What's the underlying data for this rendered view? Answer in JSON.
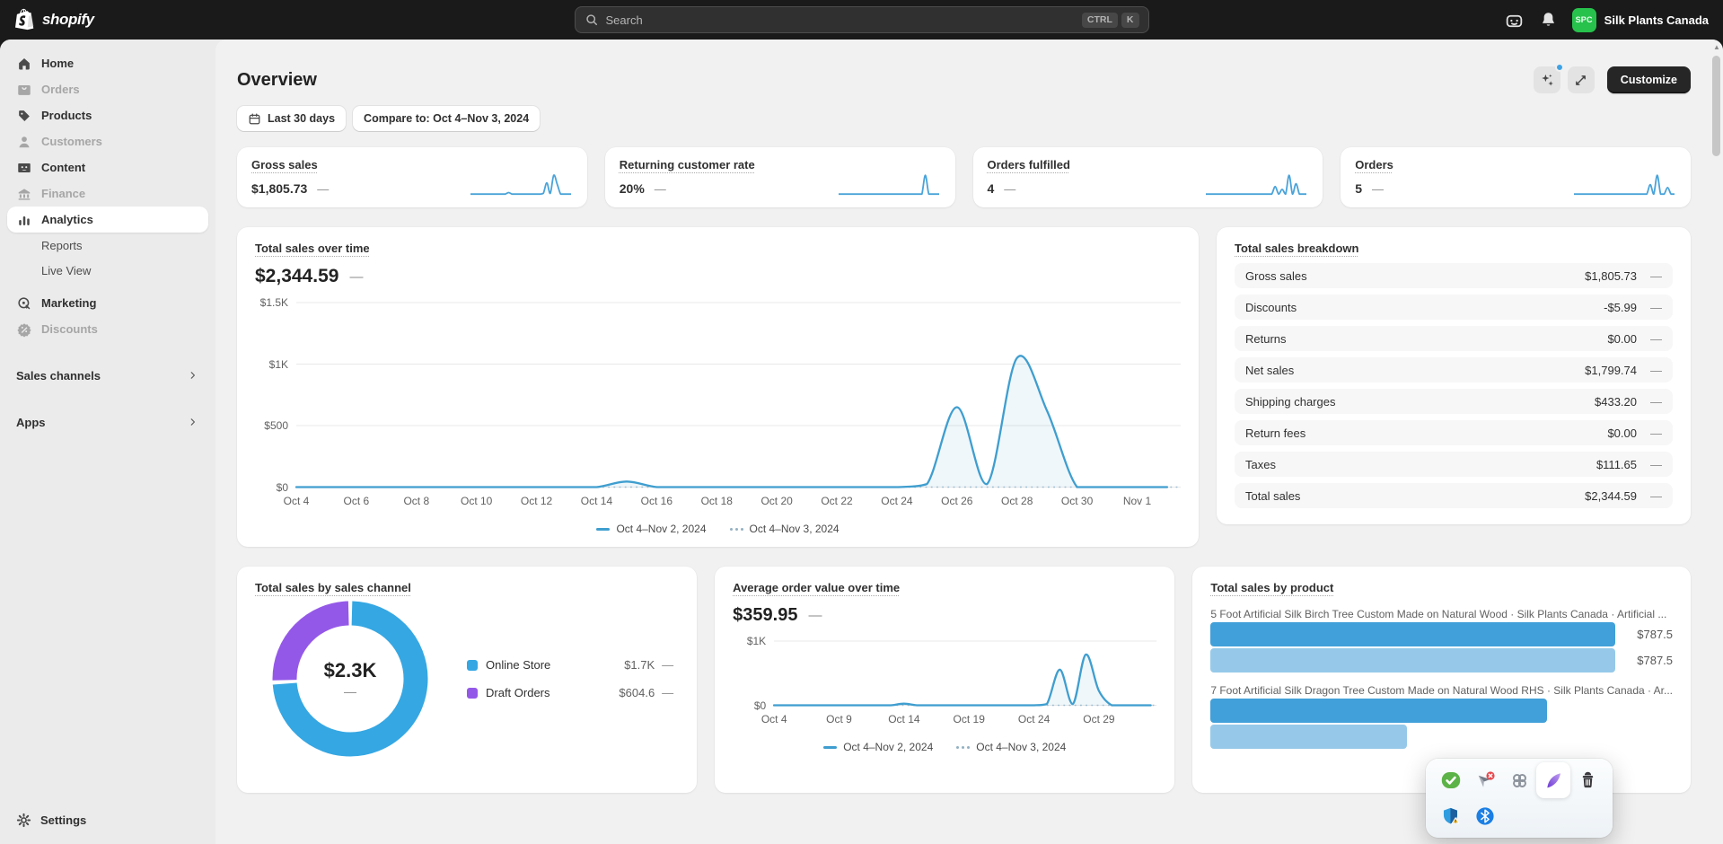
{
  "ui": {
    "dash": "—",
    "accent_blue": "#3f9ecf",
    "donut_blue": "#35a7e3",
    "donut_purple": "#9458e8",
    "bar_dark": "#41a0d9",
    "bar_light": "#96c9e9",
    "spark_color": "#4aa3d9",
    "avatar_green": "#27c24c"
  },
  "topbar": {
    "brand": "shopify",
    "search_placeholder": "Search",
    "shortcut_ctrl": "CTRL",
    "shortcut_k": "K",
    "store_initials": "SPC",
    "store_name": "Silk Plants Canada"
  },
  "sidebar": {
    "items": [
      {
        "label": "Home",
        "icon": "home",
        "state": "default"
      },
      {
        "label": "Orders",
        "icon": "orders",
        "state": "disabled"
      },
      {
        "label": "Products",
        "icon": "products",
        "state": "default"
      },
      {
        "label": "Customers",
        "icon": "customers",
        "state": "disabled"
      },
      {
        "label": "Content",
        "icon": "content",
        "state": "default"
      },
      {
        "label": "Finance",
        "icon": "finance",
        "state": "disabled"
      },
      {
        "label": "Analytics",
        "icon": "analytics",
        "state": "active"
      },
      {
        "label": "Reports",
        "icon": null,
        "state": "sub"
      },
      {
        "label": "Live View",
        "icon": null,
        "state": "sub"
      },
      {
        "label": "Marketing",
        "icon": "marketing",
        "state": "default"
      },
      {
        "label": "Discounts",
        "icon": "discounts",
        "state": "disabled"
      }
    ],
    "sections": [
      {
        "label": "Sales channels"
      },
      {
        "label": "Apps"
      }
    ],
    "settings_label": "Settings"
  },
  "page": {
    "title": "Overview",
    "customize": "Customize",
    "filters": {
      "date_range": "Last 30 days",
      "compare": "Compare to: Oct 4–Nov 3, 2024"
    }
  },
  "metrics": [
    {
      "title": "Gross sales",
      "value": "$1,805.73",
      "spark": [
        0,
        0,
        0,
        0,
        0,
        0,
        0,
        0,
        0,
        0,
        0,
        6,
        0,
        0,
        0,
        0,
        0,
        0,
        0,
        0,
        0,
        3,
        45,
        3,
        75,
        40,
        0,
        0,
        0,
        0
      ]
    },
    {
      "title": "Returning customer rate",
      "value": "20%",
      "spark": [
        0,
        0,
        0,
        0,
        0,
        0,
        0,
        0,
        0,
        0,
        0,
        0,
        0,
        0,
        0,
        0,
        0,
        0,
        0,
        0,
        0,
        0,
        0,
        0,
        0,
        100,
        0,
        0,
        0,
        0
      ]
    },
    {
      "title": "Orders fulfilled",
      "value": "4",
      "spark": [
        0,
        0,
        0,
        0,
        0,
        0,
        0,
        0,
        0,
        0,
        0,
        0,
        0,
        0,
        0,
        0,
        0,
        0,
        0,
        0,
        40,
        0,
        25,
        0,
        100,
        0,
        55,
        0,
        0,
        0
      ]
    },
    {
      "title": "Orders",
      "value": "5",
      "spark": [
        0,
        0,
        0,
        0,
        0,
        0,
        0,
        0,
        0,
        0,
        0,
        0,
        0,
        0,
        0,
        0,
        0,
        0,
        0,
        0,
        0,
        0,
        50,
        0,
        100,
        0,
        0,
        35,
        0,
        0
      ]
    }
  ],
  "chart_data": [
    {
      "id": "total-sales-over-time",
      "type": "line",
      "title": "Total sales over time",
      "value": "$2,344.59",
      "ylabel": "Total sales",
      "ymax": 1500,
      "yticks": [
        {
          "label": "$1.5K",
          "v": 1500
        },
        {
          "label": "$1K",
          "v": 1000
        },
        {
          "label": "$500",
          "v": 500
        },
        {
          "label": "$0",
          "v": 0
        }
      ],
      "xticks": [
        {
          "label": "Oct 4",
          "d": 0
        },
        {
          "label": "Oct 6",
          "d": 2
        },
        {
          "label": "Oct 8",
          "d": 4
        },
        {
          "label": "Oct 10",
          "d": 6
        },
        {
          "label": "Oct 12",
          "d": 8
        },
        {
          "label": "Oct 14",
          "d": 10
        },
        {
          "label": "Oct 16",
          "d": 12
        },
        {
          "label": "Oct 18",
          "d": 14
        },
        {
          "label": "Oct 20",
          "d": 16
        },
        {
          "label": "Oct 22",
          "d": 18
        },
        {
          "label": "Oct 24",
          "d": 20
        },
        {
          "label": "Oct 26",
          "d": 22
        },
        {
          "label": "Oct 28",
          "d": 24
        },
        {
          "label": "Oct 30",
          "d": 26
        },
        {
          "label": "Nov 1",
          "d": 28
        }
      ],
      "series": [
        {
          "name": "Oct 4–Nov 2, 2024",
          "values": [
            0,
            0,
            0,
            0,
            0,
            0,
            0,
            0,
            0,
            0,
            0,
            45,
            0,
            0,
            0,
            0,
            0,
            0,
            0,
            0,
            0,
            25,
            650,
            25,
            1050,
            620,
            0,
            0,
            0,
            0
          ]
        }
      ],
      "comparison_name": "Oct 4–Nov 3, 2024",
      "line_color": "#3f9ecf",
      "grid": true,
      "legend_position": "bottom"
    },
    {
      "id": "total-sales-by-channel",
      "type": "pie",
      "title": "Total sales by sales channel",
      "center_value": "$2.3K",
      "slices": [
        {
          "label": "Online Store",
          "value": 1739.99,
          "display": "$1.7K",
          "color": "#35a7e3"
        },
        {
          "label": "Draft Orders",
          "value": 604.6,
          "display": "$604.6",
          "color": "#9458e8"
        }
      ]
    },
    {
      "id": "average-order-value-over-time",
      "type": "line",
      "title": "Average order value over time",
      "value": "$359.95",
      "ymax": 1000,
      "yticks": [
        {
          "label": "$1K",
          "v": 1000
        },
        {
          "label": "$0",
          "v": 0
        }
      ],
      "xticks": [
        {
          "label": "Oct 4",
          "d": 0
        },
        {
          "label": "Oct 9",
          "d": 5
        },
        {
          "label": "Oct 14",
          "d": 10
        },
        {
          "label": "Oct 19",
          "d": 15
        },
        {
          "label": "Oct 24",
          "d": 20
        },
        {
          "label": "Oct 29",
          "d": 25
        }
      ],
      "series": [
        {
          "name": "Oct 4–Nov 2, 2024",
          "values": [
            0,
            0,
            0,
            0,
            0,
            0,
            0,
            0,
            0,
            0,
            25,
            0,
            0,
            0,
            0,
            0,
            0,
            0,
            0,
            0,
            0,
            20,
            555,
            20,
            790,
            230,
            0,
            0,
            0,
            0
          ]
        }
      ],
      "comparison_name": "Oct 4–Nov 3, 2024",
      "line_color": "#3f9ecf",
      "grid": true,
      "legend_position": "bottom"
    },
    {
      "id": "total-sales-by-product",
      "type": "bar",
      "title": "Total sales by product",
      "max": 787.5,
      "products": [
        {
          "name": "5 Foot Artificial Silk Birch Tree Custom Made on Natural Wood · Silk Plants Canada · Artificial ...",
          "bars": [
            {
              "value": 787.5,
              "label": "$787.5",
              "shade": "dark"
            },
            {
              "value": 787.5,
              "label": "$787.5",
              "shade": "light"
            }
          ]
        },
        {
          "name": "7 Foot Artificial Silk Dragon Tree Custom Made on Natural Wood RHS · Silk Plants Canada · Ar...",
          "bars": [
            {
              "value": 655,
              "label": "",
              "shade": "dark"
            },
            {
              "value": 382,
              "label": "",
              "shade": "light"
            }
          ]
        }
      ]
    }
  ],
  "breakdown": {
    "title": "Total sales breakdown",
    "rows": [
      {
        "label": "Gross sales",
        "value": "$1,805.73"
      },
      {
        "label": "Discounts",
        "value": "-$5.99"
      },
      {
        "label": "Returns",
        "value": "$0.00"
      },
      {
        "label": "Net sales",
        "value": "$1,799.74"
      },
      {
        "label": "Shipping charges",
        "value": "$433.20"
      },
      {
        "label": "Return fees",
        "value": "$0.00"
      },
      {
        "label": "Taxes",
        "value": "$111.65"
      },
      {
        "label": "Total sales",
        "value": "$2,344.59"
      }
    ]
  },
  "tray": {
    "icons": [
      "check-badge",
      "send-blocked",
      "extension-clover",
      "feather-pen",
      "trash",
      "security-shield-warning",
      "bluetooth"
    ]
  }
}
